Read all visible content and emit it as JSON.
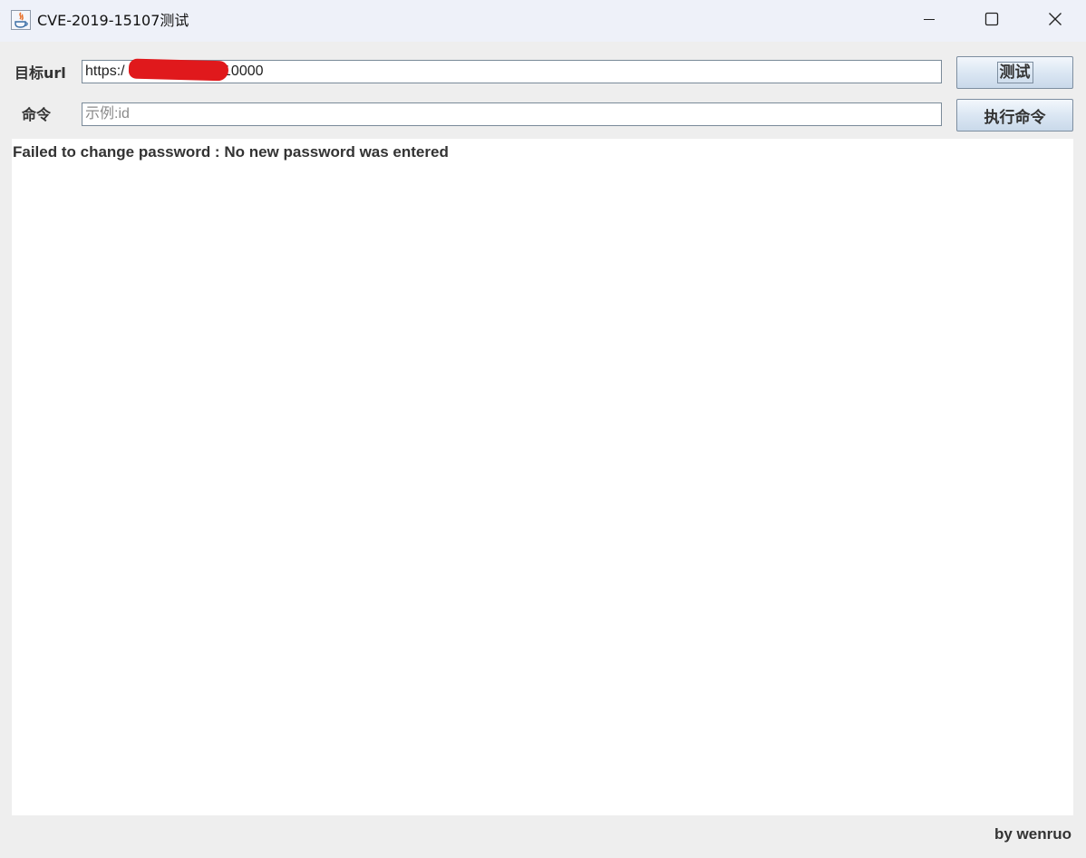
{
  "window": {
    "title": "CVE-2019-15107测试",
    "app_icon": "java-icon",
    "controls": [
      "minimize-icon",
      "maximize-icon",
      "close-icon"
    ]
  },
  "form": {
    "url_label": "目标url",
    "url_value": "https://[redacted]:10000",
    "url_value_visible_prefix": "https:/",
    "url_value_visible_suffix": ":10000",
    "command_label": "命令",
    "command_value": "",
    "command_placeholder": "示例:id"
  },
  "buttons": {
    "test_label": "测试",
    "execute_label": "执行命令"
  },
  "output": {
    "text": "Failed to change password : No new password was entered"
  },
  "footer": {
    "credit": "by wenruo"
  },
  "colors": {
    "redaction": "#e0191c",
    "titlebar": "#eef1f9",
    "window_bg": "#eeeeee"
  }
}
